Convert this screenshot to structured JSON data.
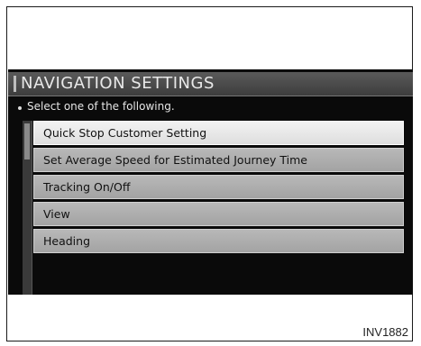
{
  "screen": {
    "title": "NAVIGATION SETTINGS",
    "prompt": "Select one of the following.",
    "menu_items": [
      {
        "label": "Quick Stop Customer Setting",
        "selected": true
      },
      {
        "label": "Set Average Speed for Estimated Journey Time",
        "selected": false
      },
      {
        "label": "Tracking On/Off",
        "selected": false
      },
      {
        "label": "View",
        "selected": false
      },
      {
        "label": "Heading",
        "selected": false
      }
    ]
  },
  "caption": "INV1882",
  "colors": {
    "screen_background": "#0a0a0a",
    "title_bar": "#4a4a4a",
    "menu_item": "#aeaeae",
    "menu_item_selected": "#e8e8e8"
  }
}
